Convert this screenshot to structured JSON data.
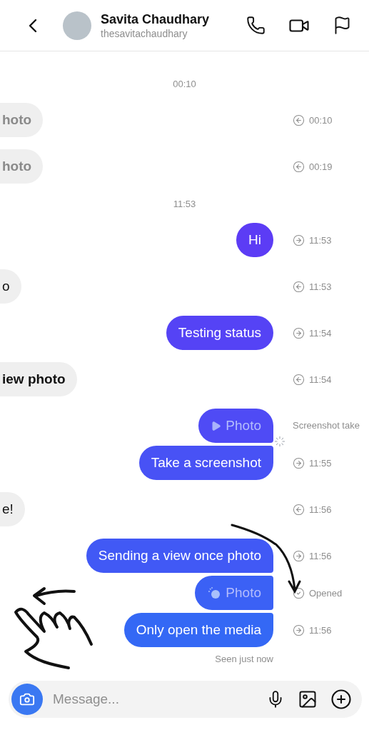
{
  "header": {
    "name": "Savita Chaudhary",
    "username": "thesavitachaudhary"
  },
  "items": [
    {
      "kind": "time",
      "text": "00:10"
    },
    {
      "kind": "expired",
      "text": "hoto",
      "meta": {
        "kind": "received",
        "text": "00:10"
      }
    },
    {
      "kind": "expired",
      "text": "hoto",
      "meta": {
        "kind": "received",
        "text": "00:19"
      }
    },
    {
      "kind": "time",
      "text": "11:53"
    },
    {
      "kind": "outgoing",
      "text": "Hi",
      "joined": false,
      "meta": {
        "kind": "sent",
        "text": "11:53"
      }
    },
    {
      "kind": "incoming",
      "text": "o",
      "meta": {
        "kind": "received",
        "text": "11:53"
      }
    },
    {
      "kind": "outgoing",
      "text": "Testing status",
      "joined": false,
      "meta": {
        "kind": "sent",
        "text": "11:54"
      }
    },
    {
      "kind": "viewlink",
      "text": "iew photo",
      "meta": {
        "kind": "received",
        "text": "11:54"
      }
    },
    {
      "kind": "photo",
      "text": "Photo",
      "joined": false,
      "screenshotted": true,
      "meta": {
        "kind": "note",
        "text": "Screenshot take"
      }
    },
    {
      "kind": "outgoing",
      "text": "Take a screenshot",
      "joined": true,
      "meta": {
        "kind": "sent",
        "text": "11:55"
      }
    },
    {
      "kind": "incoming",
      "text": "e!",
      "meta": {
        "kind": "received",
        "text": "11:56"
      }
    },
    {
      "kind": "outgoing",
      "text": "Sending a view once photo",
      "joined": false,
      "meta": {
        "kind": "sent",
        "text": "11:56"
      }
    },
    {
      "kind": "openedphoto",
      "text": "Photo",
      "joined": true,
      "meta": {
        "kind": "opened",
        "text": "Opened"
      }
    },
    {
      "kind": "outgoing",
      "text": "Only open the media",
      "joined": true,
      "meta": {
        "kind": "sent",
        "text": "11:56"
      }
    }
  ],
  "seen": "Seen just now",
  "composer": {
    "placeholder": "Message..."
  }
}
